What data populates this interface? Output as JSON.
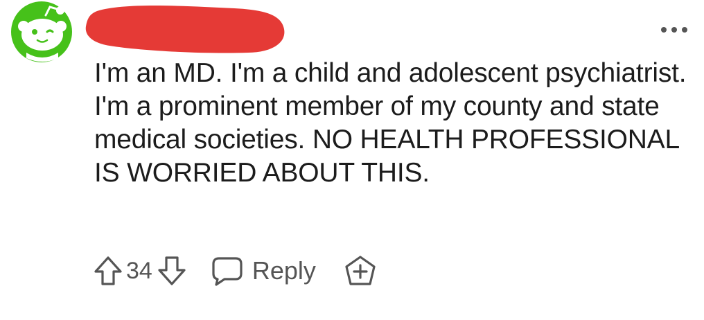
{
  "comment": {
    "author": {
      "avatar_icon": "reddit-snoo-avatar-icon",
      "avatar_color": "#46c11a",
      "username_redaction_color": "#e53a36"
    },
    "overflow_menu_icon": "more-options-icon",
    "body": "I'm an MD. I'm a child and adolescent psychiatrist. I'm a prominent member of my county and state medical societies. NO HEALTH PROFESSIONAL IS WORRIED ABOUT THIS.",
    "actions": {
      "upvote_icon": "upvote-arrow-icon",
      "vote_count": "34",
      "downvote_icon": "downvote-arrow-icon",
      "reply_icon": "speech-bubble-icon",
      "reply_label": "Reply",
      "award_icon": "award-plus-icon"
    }
  }
}
